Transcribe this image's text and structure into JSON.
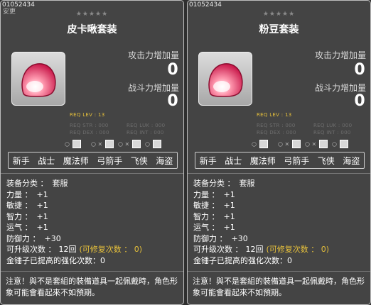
{
  "cards": [
    {
      "id": "01052434",
      "sub": "安更",
      "stars": "★★★★★",
      "title": "皮卡啾套装",
      "stat1_label": "攻击力增加量",
      "stat1_value": "0",
      "stat2_label": "战斗力增加量",
      "stat2_value": "0",
      "req": {
        "lev": "REQ LEV :  13",
        "str": "REQ STR : 000",
        "luk": "REQ LUK : 000",
        "dex": "REQ DEX : 000",
        "int": "REQ INT : 000"
      },
      "job_icons": [
        "○",
        "○ ×",
        "○ ×",
        "○"
      ],
      "jobs": [
        "新手",
        "战士",
        "魔法师",
        "弓箭手",
        "飞侠",
        "海盗"
      ],
      "props": {
        "category_label": "装备分类 ：",
        "category_value": "套服",
        "str_label": "力量 ：",
        "str_value": "+1",
        "dex_label": "敏捷 ：",
        "dex_value": "+1",
        "int_label": "智力 ：",
        "int_value": "+1",
        "luk_label": "运气 ：",
        "luk_value": "+1",
        "def_label": "防御力 ：",
        "def_value": "+30",
        "upg_label": "可升级次数 ：",
        "upg_value": "12回",
        "repair": "(可修复次数 ： 0)",
        "hammer": "金锤子已提高的强化次数：0"
      },
      "note": "注意！與不是套組的裝備道具一起佩戴時，角色形象可能會看起來不如預期。"
    },
    {
      "id": "01052434",
      "sub": "",
      "stars": "★★★★★",
      "title": "粉豆套装",
      "stat1_label": "攻击力增加量",
      "stat1_value": "0",
      "stat2_label": "战斗力增加量",
      "stat2_value": "0",
      "req": {
        "lev": "REQ LEV :  13",
        "str": "REQ STR : 000",
        "luk": "REQ LUK : 000",
        "dex": "REQ DEX : 000",
        "int": "REQ INT : 000"
      },
      "job_icons": [
        "○",
        "○ ×",
        "○ ×",
        "○"
      ],
      "jobs": [
        "新手",
        "战士",
        "魔法师",
        "弓箭手",
        "飞侠",
        "海盗"
      ],
      "props": {
        "category_label": "装备分类 ：",
        "category_value": "套服",
        "str_label": "力量 ：",
        "str_value": "+1",
        "dex_label": "敏捷 ：",
        "dex_value": "+1",
        "int_label": "智力 ：",
        "int_value": "+1",
        "luk_label": "运气 ：",
        "luk_value": "+1",
        "def_label": "防御力 ：",
        "def_value": "+30",
        "upg_label": "可升级次数 ：",
        "upg_value": "12回",
        "repair": "(可修复次数 ： 0)",
        "hammer": "金锤子已提高的强化次数：0"
      },
      "note": "注意！與不是套組的裝備道具一起佩戴時，角色形象可能會看起來不如預期。"
    }
  ],
  "colors": {
    "background": "#444444",
    "border": "#bdbdbd",
    "gold": "#e6c03b",
    "req_gray": "#6e6e6e"
  }
}
